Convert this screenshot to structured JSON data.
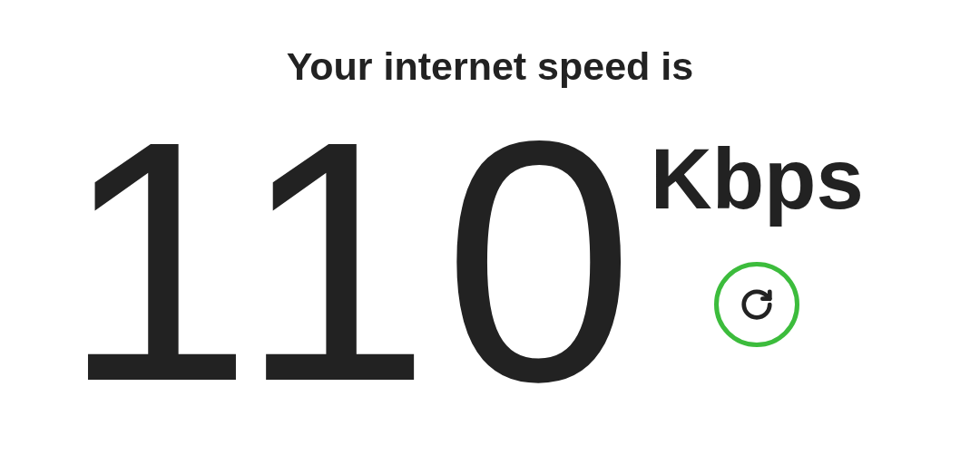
{
  "heading": "Your internet speed is",
  "speed": {
    "value": "110",
    "unit": "Kbps"
  },
  "refresh_button": {
    "kind": "refresh"
  }
}
